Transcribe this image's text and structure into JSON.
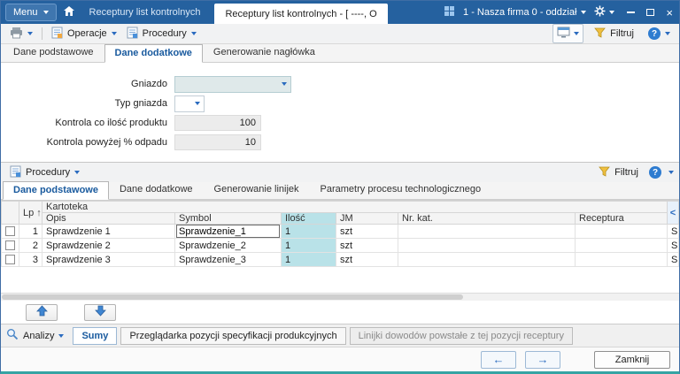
{
  "window": {
    "menu_label": "Menu",
    "tab_background_label": "Receptury list kontrolnych",
    "tab_active_label": "Receptury list kontrolnych - [ ----, O",
    "company_selector": "1 - Nasza firma 0 - oddział",
    "colors": {
      "titlebar": "#25619f",
      "accent": "#2a6bbf",
      "cell_highlight": "#b9e2e8"
    }
  },
  "icons": {
    "help": "?",
    "close": "×",
    "sort_asc": "↑",
    "collapse_left": "<",
    "arrow_left": "←",
    "arrow_right": "→"
  },
  "toolbar": {
    "operacje": "Operacje",
    "procedury": "Procedury",
    "filtruj": "Filtruj"
  },
  "header_tabs": {
    "tab1": "Dane podstawowe",
    "tab2": "Dane dodatkowe",
    "tab3": "Generowanie nagłówka"
  },
  "form": {
    "gniazdo_label": "Gniazdo",
    "gniazdo_value": "",
    "typ_gniazda_label": "Typ gniazda",
    "typ_gniazda_value": "",
    "kontrola_ilosc_label": "Kontrola co ilość produktu",
    "kontrola_ilosc_value": "100",
    "kontrola_odpad_label": "Kontrola powyżej % odpadu",
    "kontrola_odpad_value": "10"
  },
  "procedures": {
    "toolbar_label": "Procedury",
    "filtruj": "Filtruj",
    "tabs": {
      "tab1": "Dane podstawowe",
      "tab2": "Dane dodatkowe",
      "tab3": "Generowanie linijek",
      "tab4": "Parametry procesu technologicznego"
    },
    "table": {
      "col_lp": "Lp",
      "col_kartoteka": "Kartoteka",
      "col_opis": "Opis",
      "col_symbol": "Symbol",
      "col_ilosc": "Ilość",
      "col_jm": "JM",
      "col_nrkat": "Nr. kat.",
      "col_receptura": "Receptura",
      "rows": [
        {
          "lp": "1",
          "opis": "Sprawdzenie 1",
          "symbol": "Sprawdzenie_1",
          "ilosc": "1",
          "jm": "szt",
          "nrkat": "",
          "receptura": "",
          "clipped": "S"
        },
        {
          "lp": "2",
          "opis": "Sprawdzenie 2",
          "symbol": "Sprawdzenie_2",
          "ilosc": "1",
          "jm": "szt",
          "nrkat": "",
          "receptura": "",
          "clipped": "S"
        },
        {
          "lp": "3",
          "opis": "Sprawdzenie 3",
          "symbol": "Sprawdzenie_3",
          "ilosc": "1",
          "jm": "szt",
          "nrkat": "",
          "receptura": "",
          "clipped": "S"
        }
      ]
    }
  },
  "analizy": {
    "label": "Analizy",
    "tab_sumy": "Sumy",
    "tab_przegladarka": "Przeglądarka pozycji specyfikacji produkcyjnych",
    "tab_linijki": "Linijki dowodów powstałe z  tej pozycji receptury"
  },
  "footer": {
    "zamknij": "Zamknij"
  }
}
